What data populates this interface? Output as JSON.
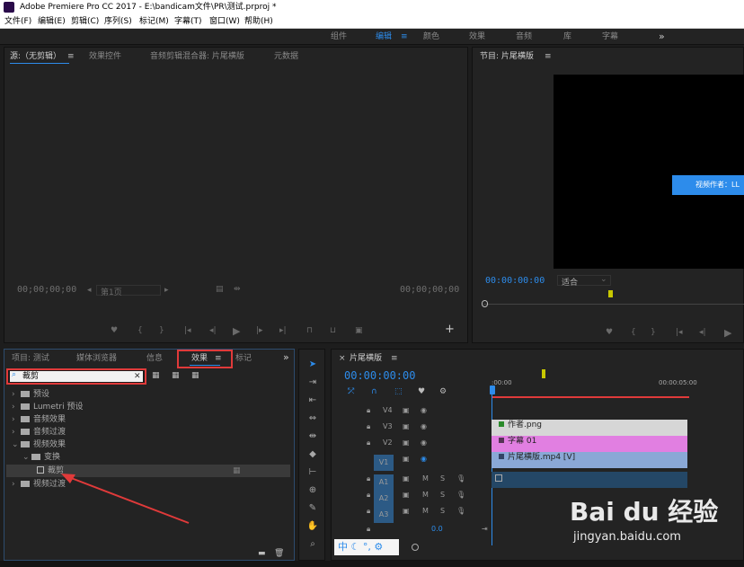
{
  "window": {
    "title": "Adobe Premiere Pro CC 2017 - E:\\bandicam文件\\PR\\测试.prproj *"
  },
  "menu": [
    "文件(F)",
    "编辑(E)",
    "剪辑(C)",
    "序列(S)",
    "标记(M)",
    "字幕(T)",
    "窗口(W)",
    "帮助(H)"
  ],
  "workspaces": {
    "items": [
      "组件",
      "编辑",
      "颜色",
      "效果",
      "音频",
      "库",
      "字幕"
    ],
    "active": "编辑",
    "more": "»"
  },
  "source_panel": {
    "tabs": [
      "源:（无剪辑）",
      "效果控件",
      "音频剪辑混合器: 片尾横版",
      "元数据"
    ],
    "timecode_left": "00;00;00;00",
    "fit": "第1页",
    "timecode_right": "00;00;00;00"
  },
  "program_panel": {
    "tab": "节目: 片尾横版",
    "timecode": "00:00:00:00",
    "fit": "适合",
    "video_label": "视频作者：LL"
  },
  "project_panel": {
    "tabs": [
      "项目: 测试",
      "媒体浏览器",
      "信息",
      "效果",
      "标记"
    ],
    "active_tab": "效果",
    "more": "»",
    "search_value": "裁剪",
    "tree": [
      {
        "label": "预设",
        "level": 0,
        "expanded": false
      },
      {
        "label": "Lumetri 预设",
        "level": 0,
        "expanded": false
      },
      {
        "label": "音频效果",
        "level": 0,
        "expanded": false
      },
      {
        "label": "音频过渡",
        "level": 0,
        "expanded": false
      },
      {
        "label": "视频效果",
        "level": 0,
        "expanded": true
      },
      {
        "label": "变换",
        "level": 1,
        "expanded": true
      },
      {
        "label": "裁剪",
        "level": 2,
        "selected": true
      },
      {
        "label": "视频过渡",
        "level": 0,
        "expanded": false
      }
    ]
  },
  "timeline": {
    "tab": "片尾横版",
    "timecode": "00:00:00:00",
    "ruler_start": ":00:00",
    "ruler_end": "00:00:05:00",
    "tracks": [
      {
        "name": "V4",
        "type": "video"
      },
      {
        "name": "V3",
        "type": "video"
      },
      {
        "name": "V2",
        "type": "video"
      },
      {
        "name": "V1",
        "type": "video",
        "target": true
      },
      {
        "name": "A1",
        "type": "audio",
        "target": true,
        "m": "M",
        "s": "S"
      },
      {
        "name": "A2",
        "type": "audio",
        "m": "M",
        "s": "S"
      },
      {
        "name": "A3",
        "type": "audio",
        "m": "M",
        "s": "S"
      }
    ],
    "master_value": "0.0",
    "clips": [
      {
        "label": "作者.png",
        "color": "#d6d6d6"
      },
      {
        "label": "字幕 01",
        "color": "#e17fe1"
      },
      {
        "label": "片尾横版.mp4 [V]",
        "color": "#8aa8d6"
      }
    ]
  },
  "watermark": {
    "logo": "Bai du 经验",
    "url": "jingyan.baidu.com"
  },
  "colors": {
    "accent_blue": "#2d8ceb",
    "highlight_red": "#e03a3a"
  }
}
